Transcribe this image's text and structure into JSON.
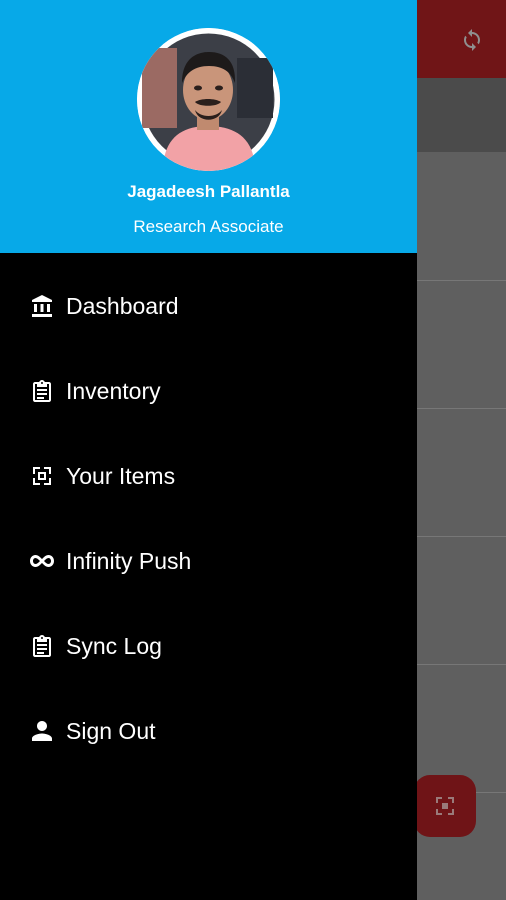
{
  "colors": {
    "header_bg": "#07a9e8",
    "drawer_bg": "#000000",
    "scrim_appbar": "#701517",
    "fab": "#6f1417"
  },
  "profile": {
    "name": "Jagadeesh Pallantla",
    "role": "Research Associate",
    "avatar_icon": "user-photo"
  },
  "menu": {
    "items": [
      {
        "label": "Dashboard",
        "icon": "bank-icon"
      },
      {
        "label": "Inventory",
        "icon": "clipboard-icon"
      },
      {
        "label": "Your Items",
        "icon": "scan-icon"
      },
      {
        "label": "Infinity Push",
        "icon": "infinity-icon"
      },
      {
        "label": "Sync Log",
        "icon": "clipboard-icon"
      },
      {
        "label": "Sign Out",
        "icon": "person-icon"
      }
    ]
  },
  "background": {
    "appbar_action_icon": "sync-icon",
    "fab_icon": "scan-icon"
  }
}
